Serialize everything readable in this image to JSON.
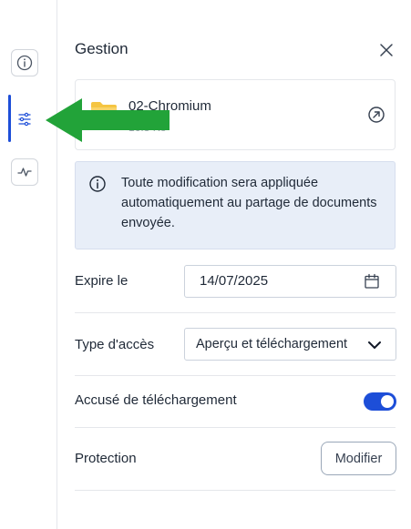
{
  "colors": {
    "accent": "#1d4ed8",
    "info_bg": "#e8eef8",
    "annotation_arrow": "#22a339",
    "folder": "#f5c542"
  },
  "rail": {
    "items": [
      {
        "name": "info",
        "icon": "info-circle-icon",
        "active": false
      },
      {
        "name": "settings",
        "icon": "sliders-icon",
        "active": true
      },
      {
        "name": "activity",
        "icon": "activity-icon",
        "active": false
      }
    ]
  },
  "panel": {
    "title": "Gestion",
    "close_icon": "close-icon"
  },
  "file": {
    "name": "02-Chromium",
    "size": "16.8 Ko",
    "icon": "folder-icon",
    "open_icon": "arrow-up-right-circle-icon"
  },
  "info": {
    "icon": "info-circle-icon",
    "text": "Toute modification sera appliquée automatiquement au partage de documents envoyée."
  },
  "expire": {
    "label": "Expire le",
    "value": "14/07/2025",
    "icon": "calendar-icon"
  },
  "access": {
    "label": "Type d'accès",
    "value": "Aperçu et téléchargement",
    "icon": "chevron-down-icon"
  },
  "receipt": {
    "label": "Accusé de téléchargement",
    "enabled": true
  },
  "protection": {
    "label": "Protection",
    "button_label": "Modifier"
  }
}
